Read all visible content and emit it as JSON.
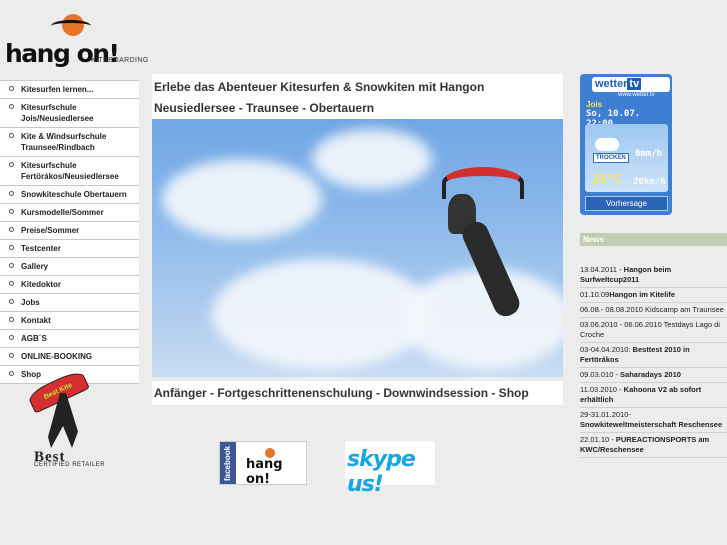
{
  "logo": {
    "brand": "hang on!",
    "sub": "KITEBOARDING"
  },
  "menu": [
    "Kitesurfen lernen...",
    "Kitesurfschule Jois/Neusiedlersee",
    "Kite & Windsurfschule Traunsee/Rindbach",
    "Kitesurfschule Fertörákos/Neusiedlersee",
    "Snowkiteschule Obertauern",
    "Kursmodelle/Sommer",
    "Preise/Sommer",
    "Testcenter",
    "Gallery",
    "Kitedoktor",
    "Jobs",
    "Kontakt",
    "AGB´S",
    "ONLINE-BOOKING",
    "Shop"
  ],
  "main": {
    "headline1": "Erlebe das Abenteuer Kitesurfen & Snowkiten mit Hangon",
    "headline2": "Neusiedlersee - Traunsee - Obertauern",
    "subline": "Anfänger - Fortgeschrittenenschulung - Downwindsession - Shop"
  },
  "badge": {
    "kite": "Best Kite",
    "best": "Best",
    "retailer": "CERTIFIED RETAILER"
  },
  "social": {
    "facebook_side": "facebook",
    "facebook_text": "hang on!",
    "skype": "skype us!"
  },
  "weather": {
    "logo_a": "wetter",
    "logo_b": "tv",
    "url": "www.wetter.tv",
    "location": "Jois",
    "date": "So, 10.07. 22:00",
    "condition": "TROCKEN",
    "temp": "25°C",
    "rain": "0mm/h",
    "wind": "20km/h",
    "forecast": "Vorhersage"
  },
  "news": {
    "title": "News",
    "items": [
      {
        "date": "13.04.2011 - ",
        "text": "Hangon beim Surfweltcup2011",
        "bold": true
      },
      {
        "date": "01.10.09",
        "text": "Hangon im Kitelife",
        "bold": true
      },
      {
        "date": "06.08.- 08.08.2010 Kidscamp am Traunsee",
        "text": "",
        "bold": false
      },
      {
        "date": "03.06.2010 - 06.06.2010 Testdays Lago di Croche",
        "text": "",
        "bold": false
      },
      {
        "date": "03-04.04.2010: ",
        "text": "Besttest 2010 in Fertörákos",
        "bold": true
      },
      {
        "date": "09.03.010 - ",
        "text": "Saharadays 2010",
        "bold": true
      },
      {
        "date": "11.03.2010 - ",
        "text": "Kahoona V2 ab sofort erhältlich",
        "bold": true
      },
      {
        "date": "29-31.01.2010-",
        "text": "Snowkiteweltmeisterschaft Reschensee",
        "bold": true
      },
      {
        "date": "22.01.10 - ",
        "text": "PUREACTIONSPORTS am KWC/Reschensee",
        "bold": true
      }
    ]
  }
}
